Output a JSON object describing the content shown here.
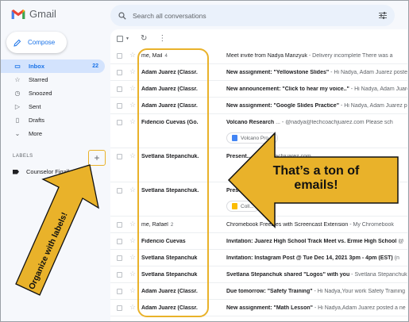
{
  "app": {
    "name": "Gmail"
  },
  "search": {
    "placeholder": "Search all conversations"
  },
  "compose": {
    "label": "Compose"
  },
  "nav": [
    {
      "label": "Inbox",
      "count": "22",
      "icon": "inbox-icon"
    },
    {
      "label": "Starred",
      "count": "",
      "icon": "star-icon"
    },
    {
      "label": "Snoozed",
      "count": "",
      "icon": "clock-icon"
    },
    {
      "label": "Sent",
      "count": "",
      "icon": "send-icon"
    },
    {
      "label": "Drafts",
      "count": "",
      "icon": "draft-icon"
    },
    {
      "label": "More",
      "count": "",
      "icon": "chevron-down-icon"
    }
  ],
  "labels": {
    "heading": "LABELS",
    "add_symbol": "+",
    "items": [
      "Counselor Figallo"
    ]
  },
  "emails": [
    {
      "from": "me, Mail",
      "thread": "4",
      "subject": "Meet invite from Nadya Manzyuk",
      "snippet": " - Delivery incomplete There was a",
      "unread": false
    },
    {
      "from": "Adam Juarez (Classr.",
      "thread": "",
      "subject": "New assignment: \"Yellowstone Slides\"",
      "snippet": " - Hi Nadya, Adam Juarez posted",
      "unread": true
    },
    {
      "from": "Adam Juarez (Classr.",
      "thread": "",
      "subject": "New announcement: \"Click to hear my voice..\"",
      "snippet": " - Hi Nadya, Adam Juarez po",
      "unread": true
    },
    {
      "from": "Adam Juarez (Classr.",
      "thread": "",
      "subject": "New assignment: \"Google Slides Practice\"",
      "snippet": " - Hi Nadya, Adam Juarez posted",
      "unread": true
    },
    {
      "from": "Fidencio Cuevas (Go.",
      "thread": "",
      "subject": "Volcano Research",
      "snippet": " ... - @nadya@techcoachjuarez.com Please sch",
      "unread": true,
      "tall": true,
      "attachment": "Volcano Pro..."
    },
    {
      "from": "Svetlana Stepanchuk.",
      "thread": "",
      "subject": "Present...",
      "snippet": "  @techcoachjuarez.com",
      "unread": true,
      "tall": true
    },
    {
      "from": "Svetlana Stepanchuk.",
      "thread": "",
      "subject": "Present...",
      "snippet": "  @techcoachjuarez.com",
      "unread": true,
      "tall": true,
      "attachment": "Coll..."
    },
    {
      "from": "me, Rafael",
      "thread": "2",
      "subject": "Chromebook Freebies with Screencast Extension",
      "snippet": " - My Chromebook",
      "unread": false
    },
    {
      "from": "Fidencio Cuevas",
      "thread": "",
      "subject": "Invitation: Juarez High School Track Meet vs. Ermie High School",
      "snippet": " @",
      "unread": true
    },
    {
      "from": "Svetlana Stepanchuk",
      "thread": "",
      "subject": "Invitation: Instagram Post @ Tue Dec 14, 2021 3pm - 4pm (EST)",
      "snippet": " (n",
      "unread": true
    },
    {
      "from": "Svetlana Stepanchuk",
      "thread": "",
      "subject": "Svetlana Stepanchuk shared \"Logos\" with you",
      "snippet": " - Svetlana Stepanchuk",
      "unread": true
    },
    {
      "from": "Adam Juarez (Classr.",
      "thread": "",
      "subject": "Due tomorrow: \"Safety Training\"",
      "snippet": " - Hi Nadya,Your work Safety Training",
      "unread": true
    },
    {
      "from": "Adam Juarez (Classr.",
      "thread": "",
      "subject": "New assignment: \"Math Lesson\"",
      "snippet": " - Hi Nadya,Adam Juarez posted a ne",
      "unread": true
    }
  ],
  "annotations": {
    "callout_line1": "That’s a ton of",
    "callout_line2": "emails!",
    "diagonal": "Organize with labels!"
  },
  "colors": {
    "accent": "#1a73e8",
    "highlight": "#e9b22a",
    "arrow_fill": "#e9b22a",
    "gmail_red": "#ea4335"
  }
}
